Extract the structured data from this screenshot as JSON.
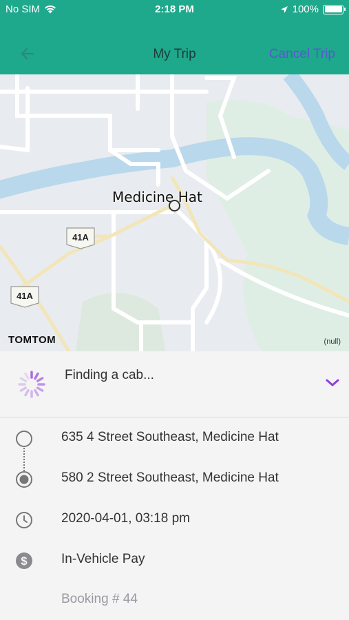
{
  "status_bar": {
    "carrier": "No SIM",
    "time": "2:18 PM",
    "battery": "100%"
  },
  "nav": {
    "title": "My Trip",
    "cancel_label": "Cancel Trip"
  },
  "map": {
    "city": "Medicine Hat",
    "highway_1": "41A",
    "highway_2": "41A",
    "brand": "TOMTOM",
    "null_label": "(null)"
  },
  "trip_status": {
    "text": "Finding a cab..."
  },
  "trip": {
    "pickup": "635 4 Street Southeast, Medicine Hat",
    "dropoff": "580 2 Street Southeast, Medicine Hat",
    "datetime": "2020-04-01, 03:18 pm",
    "payment": "In-Vehicle Pay",
    "booking": "Booking # 44"
  },
  "colors": {
    "accent": "#1ea88c",
    "cancel": "#5b57cf",
    "spinner": "#a96be0"
  },
  "icons": [
    "wifi-icon",
    "location-arrow-icon",
    "battery-icon",
    "back-arrow-icon",
    "spinner-icon",
    "chevron-down-icon",
    "pickup-circle-icon",
    "dropoff-radio-icon",
    "clock-icon",
    "dollar-icon"
  ]
}
